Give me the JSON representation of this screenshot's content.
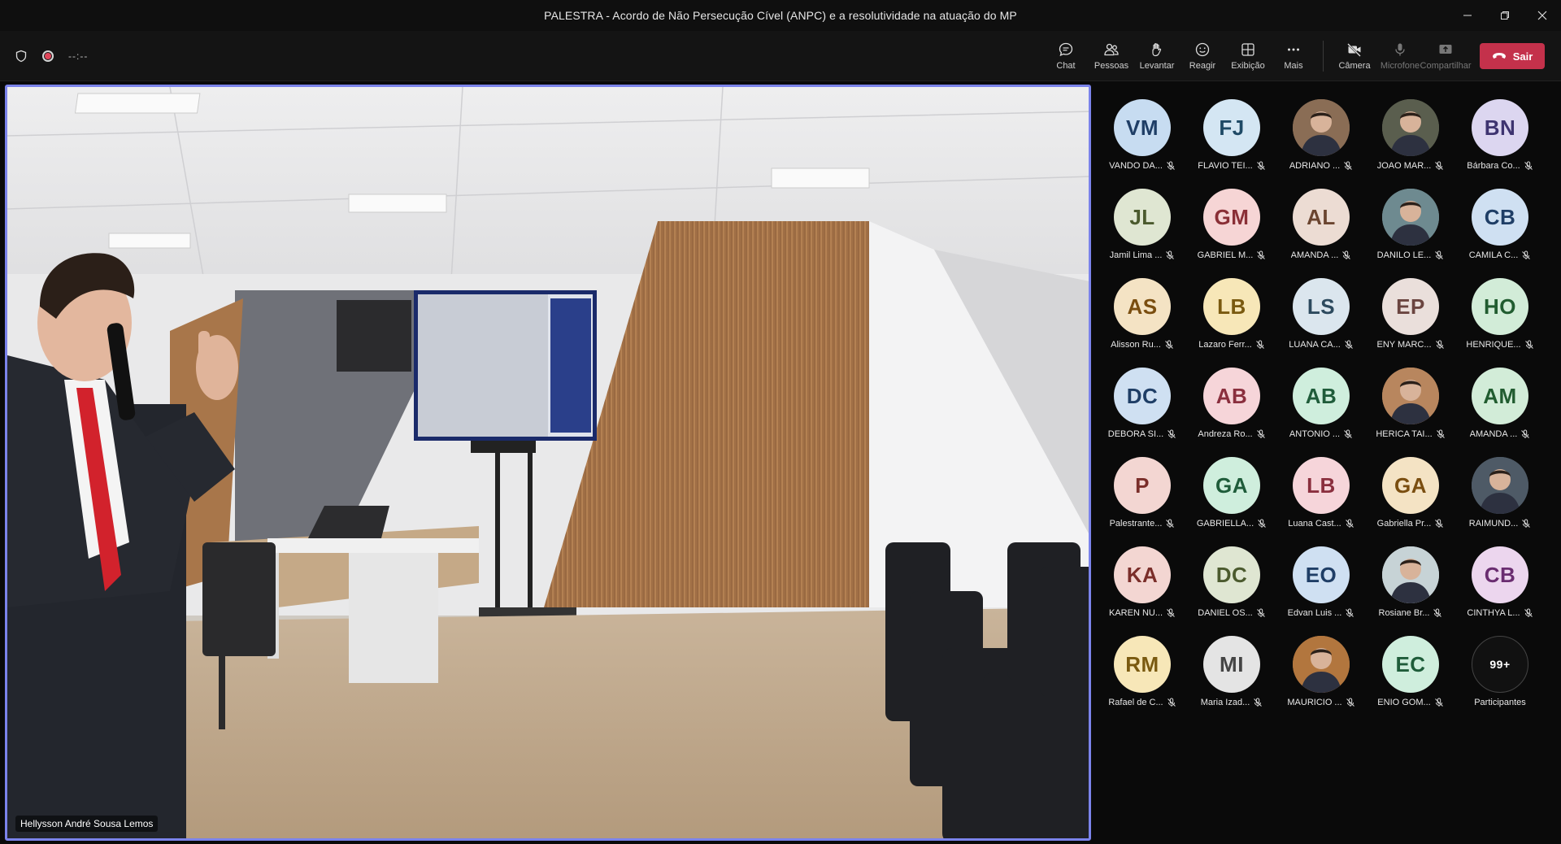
{
  "window": {
    "title": "PALESTRA - Acordo de Não Persecução Cível (ANPC) e a resolutividade na atuação do MP"
  },
  "toolbar": {
    "timer": "--:--",
    "chat_label": "Chat",
    "people_label": "Pessoas",
    "raise_label": "Levantar",
    "react_label": "Reagir",
    "view_label": "Exibição",
    "more_label": "Mais",
    "camera_label": "Câmera",
    "mic_label": "Microfone",
    "share_label": "Compartilhar",
    "leave_label": "Sair"
  },
  "stage": {
    "speaker_name": "Hellysson André Sousa Lemos"
  },
  "participants": [
    {
      "initials": "VM",
      "name": "VANDO DA...",
      "bg": "#c7dcf1",
      "fg": "#1f3e66"
    },
    {
      "initials": "FJ",
      "name": "FLAVIO TEI...",
      "bg": "#d4e6f3",
      "fg": "#1f4a66"
    },
    {
      "initials": "",
      "name": "ADRIANO ...",
      "bg": "#8a6d55",
      "fg": "#fff",
      "photo": true
    },
    {
      "initials": "",
      "name": "JOAO MAR...",
      "bg": "#5a5e4e",
      "fg": "#fff",
      "photo": true
    },
    {
      "initials": "BN",
      "name": "Bárbara Co...",
      "bg": "#dcd6f0",
      "fg": "#3e3470"
    },
    {
      "initials": "JL",
      "name": "Jamil Lima ...",
      "bg": "#dfe6d2",
      "fg": "#4b5a2e"
    },
    {
      "initials": "GM",
      "name": "GABRIEL M...",
      "bg": "#f6d5d5",
      "fg": "#8a2f36"
    },
    {
      "initials": "AL",
      "name": "AMANDA ...",
      "bg": "#ecdcd3",
      "fg": "#6b4530"
    },
    {
      "initials": "",
      "name": "DANILO LE...",
      "bg": "#6e8a90",
      "fg": "#fff",
      "photo": true
    },
    {
      "initials": "CB",
      "name": "CAMILA C...",
      "bg": "#cfe0f2",
      "fg": "#1f3e66"
    },
    {
      "initials": "AS",
      "name": "Alisson Ru...",
      "bg": "#f4e3c4",
      "fg": "#7a4e10"
    },
    {
      "initials": "LB",
      "name": "Lazaro Ferr...",
      "bg": "#f7e7b8",
      "fg": "#7a5a10"
    },
    {
      "initials": "LS",
      "name": "LUANA CA...",
      "bg": "#dbe6ee",
      "fg": "#2d4a5e"
    },
    {
      "initials": "EP",
      "name": "ENY MARC...",
      "bg": "#eadfdb",
      "fg": "#6b4540"
    },
    {
      "initials": "HO",
      "name": "HENRIQUE...",
      "bg": "#d2ecd8",
      "fg": "#215c30"
    },
    {
      "initials": "DC",
      "name": "DEBORA SI...",
      "bg": "#cfe0f2",
      "fg": "#1f3e66"
    },
    {
      "initials": "AB",
      "name": "Andreza Ro...",
      "bg": "#f6d5d9",
      "fg": "#8a2f3e"
    },
    {
      "initials": "AB",
      "name": "ANTONIO ...",
      "bg": "#cfeedd",
      "fg": "#1f5c3a"
    },
    {
      "initials": "",
      "name": "HERICA TAI...",
      "bg": "#b8865e",
      "fg": "#fff",
      "photo": true
    },
    {
      "initials": "AM",
      "name": "AMANDA ...",
      "bg": "#d2ecd8",
      "fg": "#215c30"
    },
    {
      "initials": "P",
      "name": "Palestrante...",
      "bg": "#f3d6d2",
      "fg": "#7a2e2a"
    },
    {
      "initials": "GA",
      "name": "GABRIELLA...",
      "bg": "#cfeedd",
      "fg": "#1f5c3a"
    },
    {
      "initials": "LB",
      "name": "Luana Cast...",
      "bg": "#f6d5da",
      "fg": "#8a2f3e"
    },
    {
      "initials": "GA",
      "name": "Gabriella Pr...",
      "bg": "#f4e3c4",
      "fg": "#7a4e10"
    },
    {
      "initials": "",
      "name": "RAIMUND...",
      "bg": "#4e5a66",
      "fg": "#fff",
      "photo": true
    },
    {
      "initials": "KA",
      "name": "KAREN NU...",
      "bg": "#f3d6d2",
      "fg": "#7a2e2a"
    },
    {
      "initials": "DC",
      "name": "DANIEL OS...",
      "bg": "#dfe6d2",
      "fg": "#4b5a2e"
    },
    {
      "initials": "EO",
      "name": "Edvan Luis ...",
      "bg": "#cfe0f2",
      "fg": "#1f3e66"
    },
    {
      "initials": "",
      "name": "Rosiane Br...",
      "bg": "#c7d3d6",
      "fg": "#fff",
      "photo": true
    },
    {
      "initials": "CB",
      "name": "CINTHYA L...",
      "bg": "#ecd6ee",
      "fg": "#6a2d70"
    },
    {
      "initials": "RM",
      "name": "Rafael de C...",
      "bg": "#f7e7b8",
      "fg": "#7a5a10"
    },
    {
      "initials": "MI",
      "name": "Maria Izad...",
      "bg": "#e4e4e4",
      "fg": "#444"
    },
    {
      "initials": "",
      "name": "MAURICIO ...",
      "bg": "#b2763e",
      "fg": "#fff",
      "photo": true
    },
    {
      "initials": "EC",
      "name": "ENIO GOM...",
      "bg": "#cfeedd",
      "fg": "#1f5c3a"
    }
  ],
  "overflow": {
    "count": "99+",
    "label": "Participantes"
  }
}
